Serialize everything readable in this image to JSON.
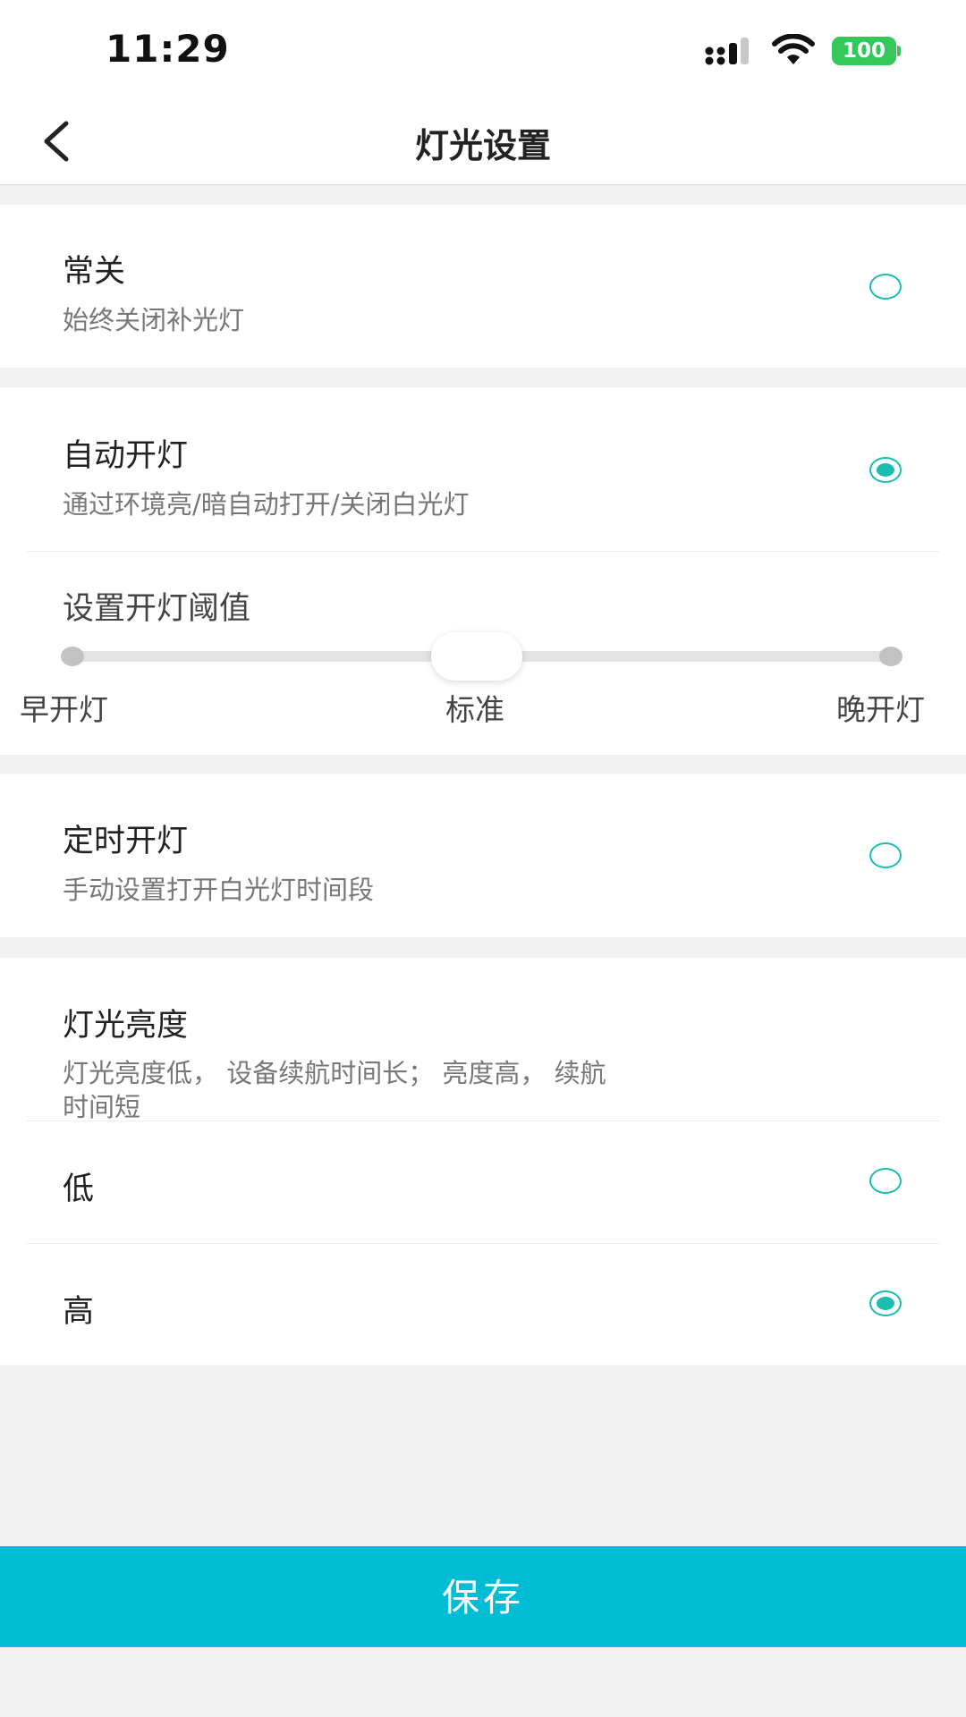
{
  "status_bar": {
    "time": "11:29",
    "battery": "100",
    "signal_icon": "cellular-signal-icon",
    "wifi_icon": "wifi-icon"
  },
  "nav": {
    "title": "灯光设置",
    "back_icon": "chevron-left-icon"
  },
  "modes": {
    "always_off": {
      "title": "常关",
      "subtitle": "始终关闭补光灯",
      "selected": false
    },
    "auto_on": {
      "title": "自动开灯",
      "subtitle": "通过环境亮/暗自动打开/关闭白光灯",
      "selected": true
    },
    "threshold": {
      "title": "设置开灯阈值",
      "label_left": "早开灯",
      "label_mid": "标准",
      "label_right": "晚开灯",
      "value": 0.5
    },
    "scheduled_on": {
      "title": "定时开灯",
      "subtitle": "手动设置打开白光灯时间段",
      "selected": false
    }
  },
  "brightness": {
    "title": "灯光亮度",
    "subtitle_line1": "灯光亮度低， 设备续航时间长； 亮度高， 续航",
    "subtitle_line2": "时间短",
    "options": [
      {
        "label": "低",
        "selected": false
      },
      {
        "label": "高",
        "selected": true
      }
    ]
  },
  "save_label": "保存",
  "colors": {
    "accent": "#1bbdb0",
    "save_button": "#00bcd4",
    "background": "#f2f2f2"
  }
}
